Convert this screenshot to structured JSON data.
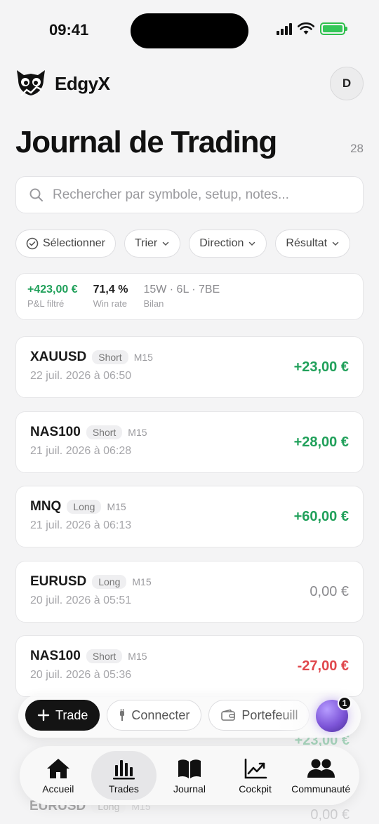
{
  "status_bar": {
    "time": "09:41"
  },
  "app": {
    "name": "EdgyX",
    "avatar_initial": "D"
  },
  "page": {
    "title": "Journal de Trading",
    "count": "28"
  },
  "search": {
    "placeholder": "Rechercher par symbole, setup, notes..."
  },
  "filters": [
    {
      "label": "Sélectionner"
    },
    {
      "label": "Trier"
    },
    {
      "label": "Direction"
    },
    {
      "label": "Résultat"
    }
  ],
  "summary": {
    "pnl_value": "+423,00 €",
    "pnl_label": "P&L filtré",
    "winrate_value": "71,4 %",
    "winrate_label": "Win rate",
    "record_value": "15W · 6L · 7BE",
    "record_label": "Bilan"
  },
  "trades": [
    {
      "symbol": "XAUUSD",
      "direction": "Short",
      "timeframe": "M15",
      "date": "22 juil. 2026 à 06:50",
      "pnl": "+23,00 €"
    },
    {
      "symbol": "NAS100",
      "direction": "Short",
      "timeframe": "M15",
      "date": "21 juil. 2026 à 06:28",
      "pnl": "+28,00 €"
    },
    {
      "symbol": "MNQ",
      "direction": "Long",
      "timeframe": "M15",
      "date": "21 juil. 2026 à 06:13",
      "pnl": "+60,00 €"
    },
    {
      "symbol": "EURUSD",
      "direction": "Long",
      "timeframe": "M15",
      "date": "20 juil. 2026 à 05:51",
      "pnl": "0,00 €"
    },
    {
      "symbol": "NAS100",
      "direction": "Short",
      "timeframe": "M15",
      "date": "20 juil. 2026 à 05:36",
      "pnl": "-27,00 €"
    }
  ],
  "ghost_trades": [
    {
      "pnl": "+23,00 €"
    },
    {
      "symbol": "EURUSD",
      "direction": "Long",
      "timeframe": "M15",
      "pnl": "0,00 €"
    }
  ],
  "quick_actions": {
    "trade": "Trade",
    "connect": "Connecter",
    "wallet": "Portefeuill"
  },
  "assistant": {
    "badge": "1"
  },
  "tabs": [
    {
      "label": "Accueil"
    },
    {
      "label": "Trades"
    },
    {
      "label": "Journal"
    },
    {
      "label": "Cockpit"
    },
    {
      "label": "Communauté"
    }
  ],
  "colors": {
    "positive": "#20a05a",
    "negative": "#e0474c",
    "neutral": "#8a8a8e",
    "accent": "#141414"
  }
}
